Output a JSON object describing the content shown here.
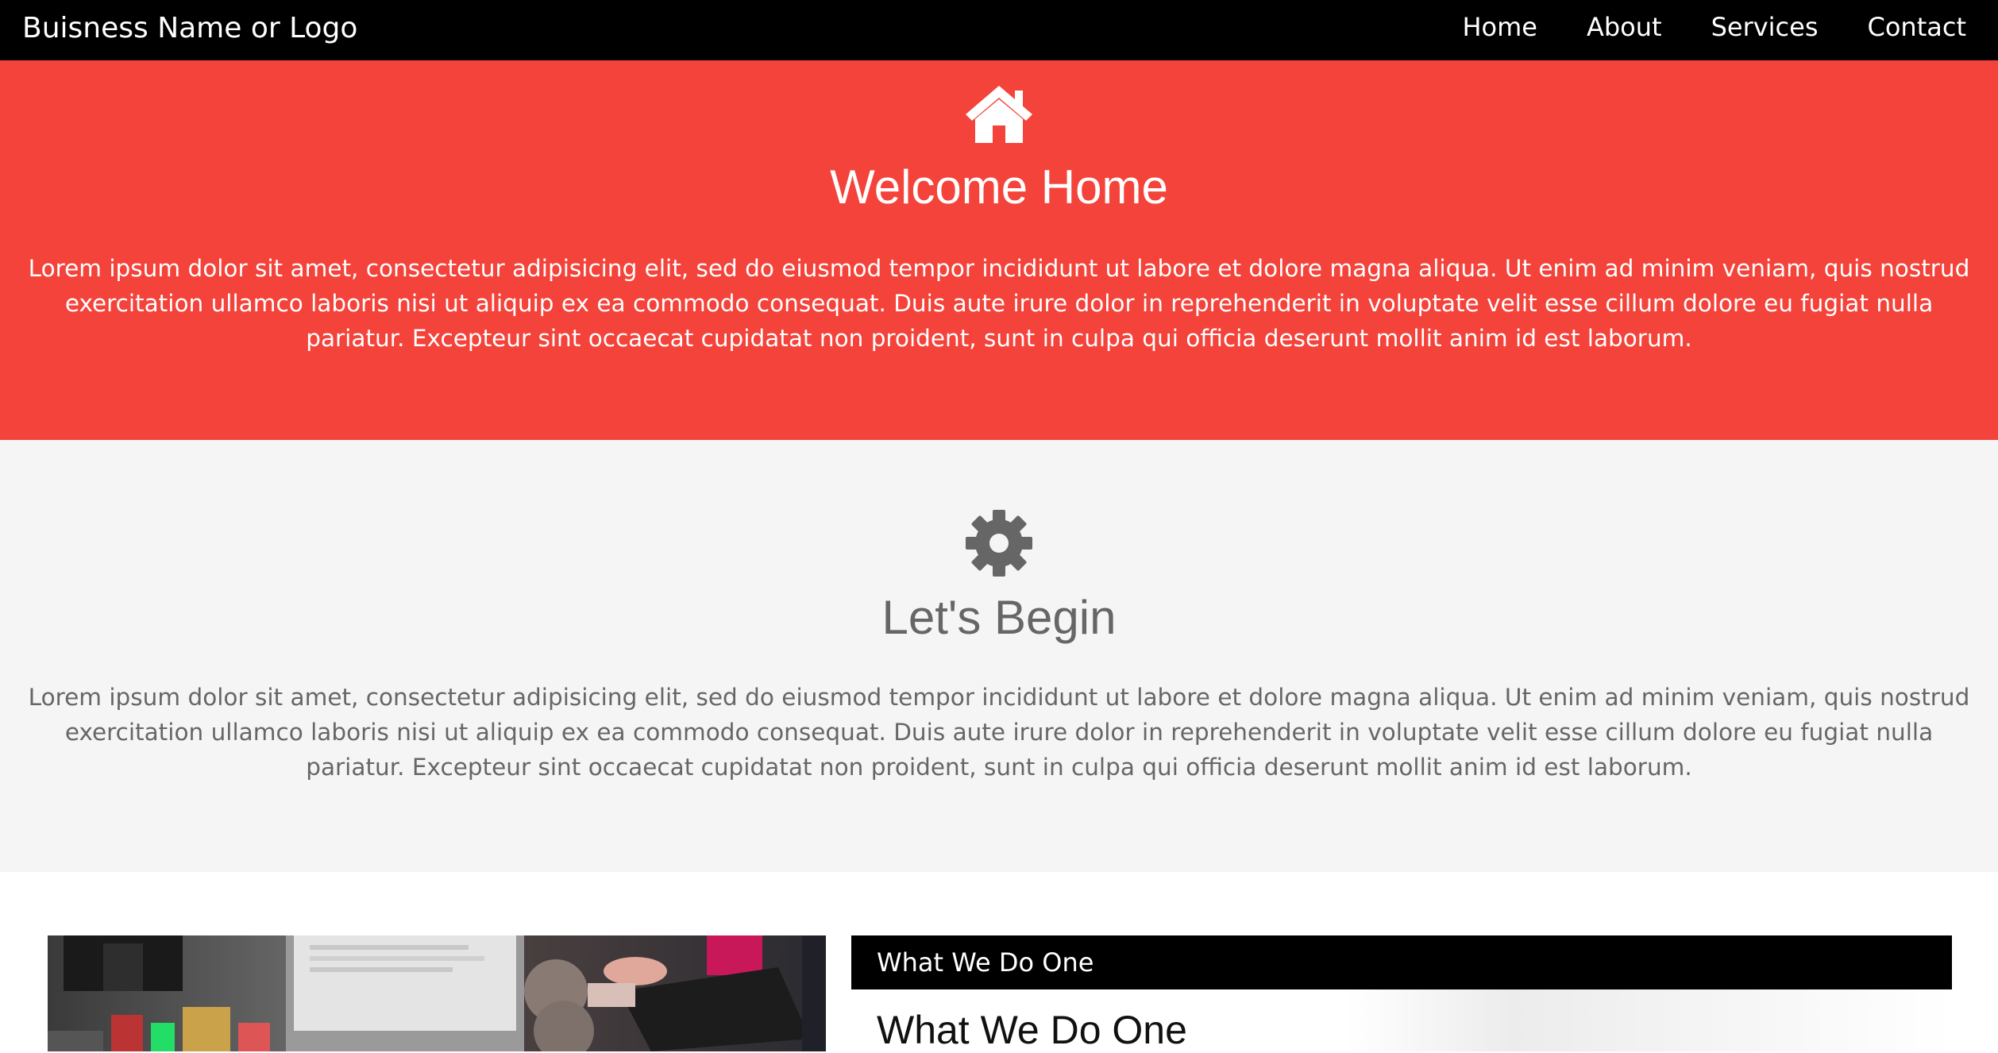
{
  "nav": {
    "brand": "Buisness Name or Logo",
    "links": [
      "Home",
      "About",
      "Services",
      "Contact"
    ]
  },
  "hero": {
    "icon": "home-icon",
    "title": "Welcome Home",
    "text": "Lorem ipsum dolor sit amet, consectetur adipisicing elit, sed do eiusmod tempor incididunt ut labore et dolore magna aliqua. Ut enim ad minim veniam, quis nostrud exercitation ullamco laboris nisi ut aliquip ex ea commodo consequat. Duis aute irure dolor in reprehenderit in voluptate velit esse cillum dolore eu fugiat nulla pariatur. Excepteur sint occaecat cupidatat non proident, sunt in culpa qui officia deserunt mollit anim id est laborum."
  },
  "begin": {
    "icon": "gear-icon",
    "title": "Let's Begin",
    "text": "Lorem ipsum dolor sit amet, consectetur adipisicing elit, sed do eiusmod tempor incididunt ut labore et dolore magna aliqua. Ut enim ad minim veniam, quis nostrud exercitation ullamco laboris nisi ut aliquip ex ea commodo consequat. Duis aute irure dolor in reprehenderit in voluptate velit esse cillum dolore eu fugiat nulla pariatur. Excepteur sint occaecat cupidatat non proident, sunt in culpa qui officia deserunt mollit anim id est laborum."
  },
  "what": {
    "header": "What We Do One",
    "title": "What We Do One"
  },
  "colors": {
    "nav_bg": "#000000",
    "hero_bg": "#f4433a",
    "begin_bg": "#f5f5f5",
    "begin_text": "#666666"
  }
}
